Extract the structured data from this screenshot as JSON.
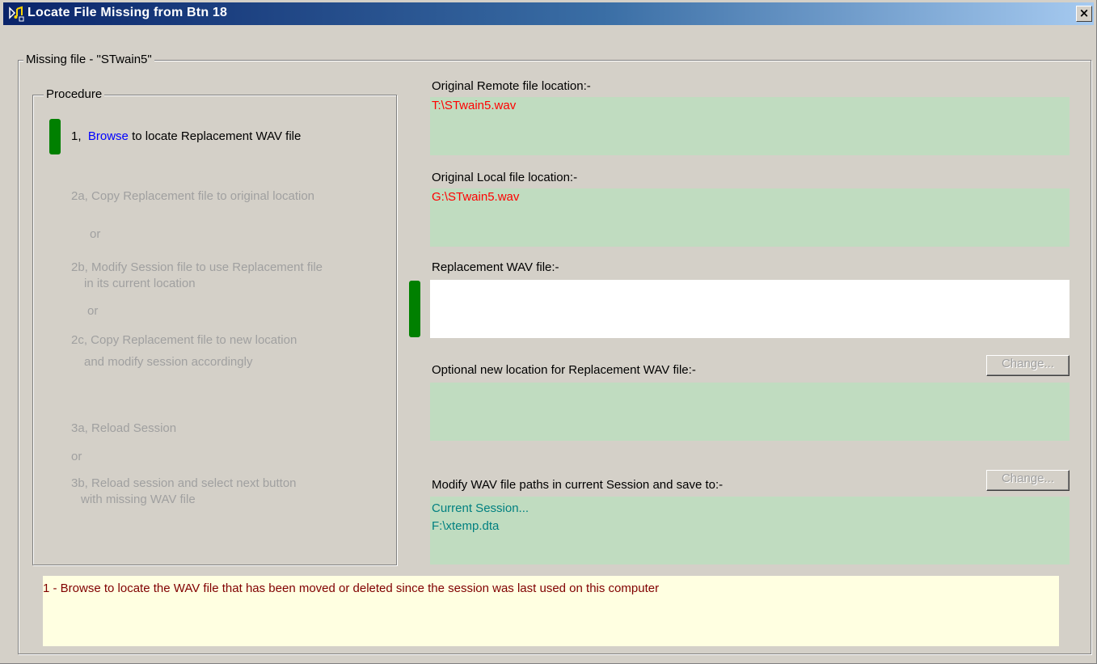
{
  "window": {
    "title": "Locate File Missing from Btn 18",
    "close_glyph": "×",
    "icon": "music-file-icon"
  },
  "group": {
    "legend": "Missing file - \"STwain5\""
  },
  "procedure": {
    "legend": "Procedure",
    "step1_prefix": "1,",
    "step1_link": "Browse",
    "step1_rest": "to locate Replacement WAV file",
    "step2a": "2a, Copy Replacement file to original location",
    "or1": "or",
    "step2b_line1": "2b, Modify Session file to use Replacement file",
    "step2b_line2": "in its current location",
    "or2": "or",
    "step2c_line1": "2c, Copy Replacement file to new location",
    "step2c_line2": "and modify session accordingly",
    "step3a": "3a, Reload Session",
    "or3": "or",
    "step3b_line1": "3b, Reload session and select next button",
    "step3b_line2": "with missing WAV file"
  },
  "remote": {
    "label": "Original Remote file location:-",
    "value": "T:\\STwain5.wav"
  },
  "local": {
    "label": "Original Local file location:-",
    "value": "G:\\STwain5.wav"
  },
  "replacement": {
    "label": "Replacement WAV file:-",
    "value": ""
  },
  "new_location": {
    "label": "Optional new location for Replacement WAV file:-",
    "button": "Change..."
  },
  "session": {
    "label": "Modify WAV file paths in current Session and save to:-",
    "button": "Change...",
    "line1": "Current Session...",
    "line2": "F:\\xtemp.dta"
  },
  "status": {
    "text": "1  - Browse to locate the WAV file that has been moved or deleted since the session was last used on this computer"
  },
  "colors": {
    "field_bg": "#c0dcc0",
    "marker": "#008000",
    "status_bg": "#ffffe1",
    "path_text": "#ff0000",
    "session_text": "#008080"
  }
}
